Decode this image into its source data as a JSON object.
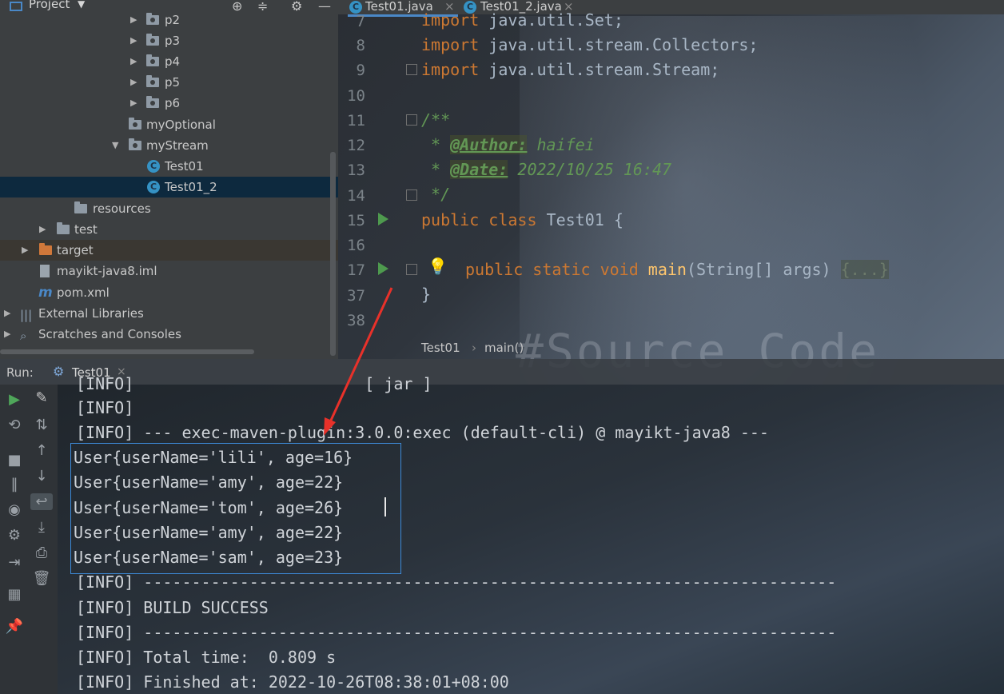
{
  "project": {
    "header_title": "Project",
    "tree": [
      {
        "label": "p2"
      },
      {
        "label": "p3"
      },
      {
        "label": "p4"
      },
      {
        "label": "p5"
      },
      {
        "label": "p6"
      },
      {
        "label": "myOptional"
      },
      {
        "label": "myStream"
      },
      {
        "label": "Test01"
      },
      {
        "label": "Test01_2"
      },
      {
        "label": "resources"
      },
      {
        "label": "test"
      },
      {
        "label": "target"
      },
      {
        "label": "mayikt-java8.iml"
      },
      {
        "label": "pom.xml"
      },
      {
        "label": "External Libraries"
      },
      {
        "label": "Scratches and Consoles"
      }
    ]
  },
  "editor": {
    "tabs": [
      {
        "label": "Test01.java"
      },
      {
        "label": "Test01_2.java"
      }
    ],
    "line_numbers": [
      "7",
      "8",
      "9",
      "10",
      "11",
      "12",
      "13",
      "14",
      "15",
      "16",
      "17",
      "37",
      "38"
    ],
    "lines": {
      "l7_kw": "import",
      "l7_rest": " java.util.Set;",
      "l8_kw": "import",
      "l8_rest": " java.util.stream.Collectors;",
      "l9_kw": "import",
      "l9_rest": " java.util.stream.Stream;",
      "l11": "/**",
      "l12_star": " * ",
      "l12_tag": "@Author:",
      "l12_val": " haifei",
      "l13_star": " * ",
      "l13_tag": "@Date:",
      "l13_val": " 2022/10/25 16:47",
      "l14": " */",
      "l15_kw": "public class",
      "l15_rest": " Test01 {",
      "l17_kw": "public static void",
      "l17_fn": " main",
      "l17_rest": "(String[] args) ",
      "l17_fold": "{...}",
      "l37": "}"
    },
    "breadcrumb": {
      "class": "Test01",
      "method": "main()"
    },
    "watermark": "#Source Code"
  },
  "run": {
    "label": "Run:",
    "tab": "Test01",
    "output": [
      "[INFO]                        [ jar ]",
      "[INFO]",
      "[INFO] --- exec-maven-plugin:3.0.0:exec (default-cli) @ mayikt-java8 ---",
      "User{userName='lili', age=16}",
      "User{userName='amy', age=22}",
      "User{userName='tom', age=26}",
      "User{userName='amy', age=22}",
      "User{userName='sam', age=23}",
      "[INFO] ------------------------------------------------------------------------",
      "[INFO] BUILD SUCCESS",
      "[INFO] ------------------------------------------------------------------------",
      "[INFO] Total time:  0.809 s",
      "[INFO] Finished at: 2022-10-26T08:38:01+08:00"
    ]
  },
  "colors": {
    "keyword": "#cc7832",
    "comment": "#629755",
    "function": "#ffc66d",
    "highlight_box": "#3d8ad8",
    "annotation_arrow": "#e8312a"
  }
}
